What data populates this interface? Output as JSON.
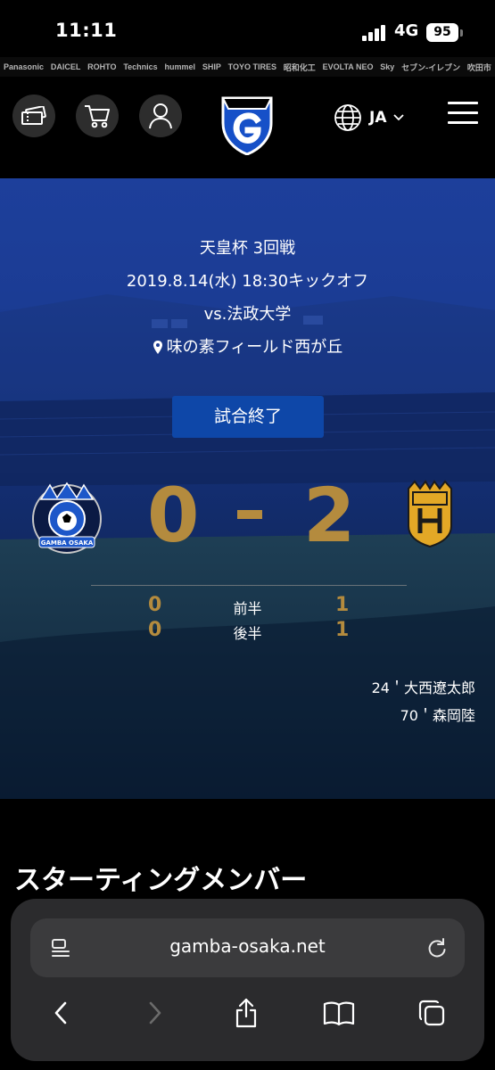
{
  "status_bar": {
    "time": "11:11",
    "network": "4G",
    "battery": "95"
  },
  "sponsors": [
    "Panasonic",
    "DAICEL",
    "ROHTO",
    "Technics",
    "hummel",
    "SHIP",
    "TOYO TIRES",
    "昭和化工",
    "EVOLTA NEO",
    "Sky",
    "セブン-イレブン",
    "吹田市"
  ],
  "header": {
    "language": "JA",
    "icons": [
      "ticket-icon",
      "cart-icon",
      "user-icon",
      "club-logo",
      "globe-icon",
      "menu-icon"
    ]
  },
  "match": {
    "competition": "天皇杯 3回戦",
    "datetime": "2019.8.14(水) 18:30キックオフ",
    "opponent": "vs.法政大学",
    "venue": "味の素フィールド西が丘",
    "status": "試合終了",
    "home_crest_text": "GAMBA OSAKA",
    "home_score": "0",
    "away_score": "2",
    "halves": [
      {
        "label": "前半",
        "home": "0",
        "away": "1"
      },
      {
        "label": "後半",
        "home": "0",
        "away": "1"
      }
    ],
    "scorers": [
      "24＇大西遼太郎",
      "70＇森岡陸"
    ]
  },
  "section": {
    "title": "スターティングメンバー"
  },
  "browser": {
    "url": "gamba-osaka.net"
  },
  "colors": {
    "accent_gold": "#b48b3e",
    "hero_blue": "#1b3c94",
    "button_blue": "#0e47a8"
  }
}
